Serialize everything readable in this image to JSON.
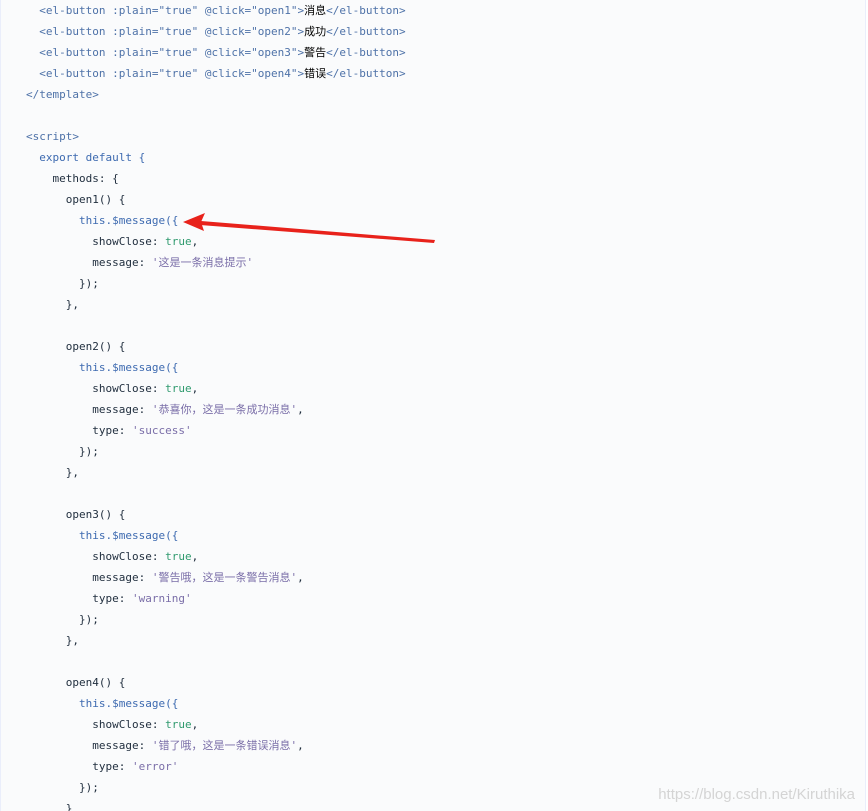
{
  "template_lines": [
    {
      "attrs": ":plain=\"true\" @click=\"open1\"",
      "label": "消息"
    },
    {
      "attrs": ":plain=\"true\" @click=\"open2\"",
      "label": "成功"
    },
    {
      "attrs": ":plain=\"true\" @click=\"open3\"",
      "label": "警告"
    },
    {
      "attrs": ":plain=\"true\" @click=\"open4\"",
      "label": "错误"
    }
  ],
  "tokens": {
    "el_button_open": "<el-button ",
    "el_button_close": "</el-button>",
    "gt": ">",
    "template_close": "</template>",
    "script_open": "<script>",
    "export_default": "export default {",
    "methods": "methods: {",
    "this_message": "this.$message({",
    "showclose_key": "showClose: ",
    "showclose_val": "true",
    "message_key": "message: ",
    "type_key": "type: ",
    "call_close": "});",
    "block_close": "},",
    "final_close": "}"
  },
  "methods": [
    {
      "name": "open1() {",
      "message": "'这是一条消息提示'",
      "type": null
    },
    {
      "name": "open2() {",
      "message": "'恭喜你，这是一条成功消息'",
      "type": "'success'"
    },
    {
      "name": "open3() {",
      "message": "'警告哦，这是一条警告消息'",
      "type": "'warning'"
    },
    {
      "name": "open4() {",
      "message": "'错了哦，这是一条错误消息'",
      "type": "'error'"
    }
  ],
  "watermark": "https://blog.csdn.net/Kiruthika",
  "colors": {
    "arrow": "#e8221b",
    "panel_bg": "#fafbfc"
  }
}
